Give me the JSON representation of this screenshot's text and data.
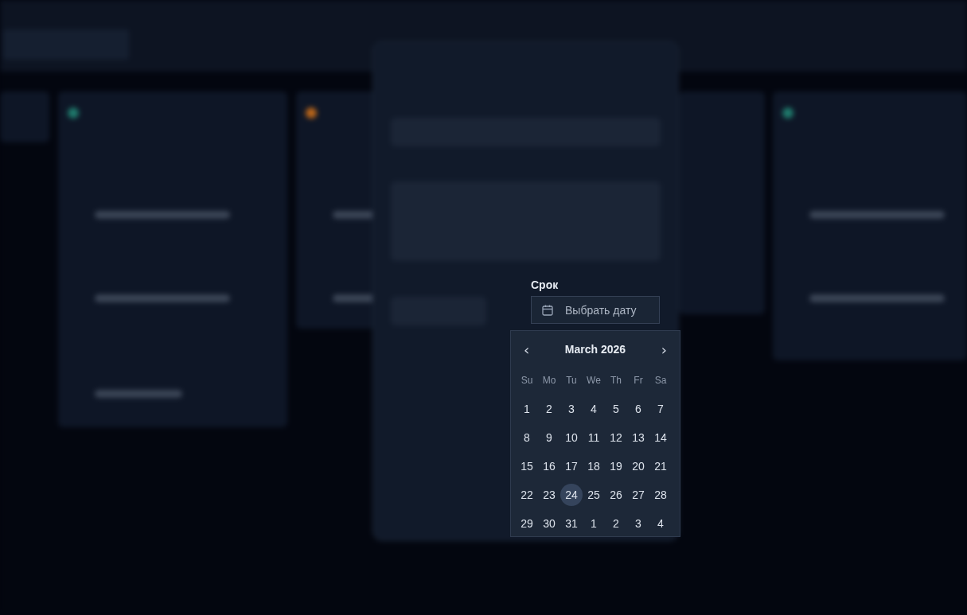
{
  "due_date": {
    "label": "Срок",
    "placeholder": "Выбрать дату"
  },
  "calendar": {
    "month": "March 2026",
    "prev": "‹",
    "next": "›",
    "weekdays": [
      "Su",
      "Mo",
      "Tu",
      "We",
      "Th",
      "Fr",
      "Sa"
    ],
    "weeks": [
      [
        {
          "day": "1",
          "highlighted": false
        },
        {
          "day": "2",
          "highlighted": false
        },
        {
          "day": "3",
          "highlighted": false
        },
        {
          "day": "4",
          "highlighted": false
        },
        {
          "day": "5",
          "highlighted": false
        },
        {
          "day": "6",
          "highlighted": false
        },
        {
          "day": "7",
          "highlighted": false
        }
      ],
      [
        {
          "day": "8",
          "highlighted": false
        },
        {
          "day": "9",
          "highlighted": false
        },
        {
          "day": "10",
          "highlighted": false
        },
        {
          "day": "11",
          "highlighted": false
        },
        {
          "day": "12",
          "highlighted": false
        },
        {
          "day": "13",
          "highlighted": false
        },
        {
          "day": "14",
          "highlighted": false
        }
      ],
      [
        {
          "day": "15",
          "highlighted": false
        },
        {
          "day": "16",
          "highlighted": false
        },
        {
          "day": "17",
          "highlighted": false
        },
        {
          "day": "18",
          "highlighted": false
        },
        {
          "day": "19",
          "highlighted": false
        },
        {
          "day": "20",
          "highlighted": false
        },
        {
          "day": "21",
          "highlighted": false
        }
      ],
      [
        {
          "day": "22",
          "highlighted": false
        },
        {
          "day": "23",
          "highlighted": false
        },
        {
          "day": "24",
          "highlighted": true
        },
        {
          "day": "25",
          "highlighted": false
        },
        {
          "day": "26",
          "highlighted": false
        },
        {
          "day": "27",
          "highlighted": false
        },
        {
          "day": "28",
          "highlighted": false
        }
      ],
      [
        {
          "day": "29",
          "highlighted": false
        },
        {
          "day": "30",
          "highlighted": false
        },
        {
          "day": "31",
          "highlighted": false
        },
        {
          "day": "1",
          "highlighted": false
        },
        {
          "day": "2",
          "highlighted": false
        },
        {
          "day": "3",
          "highlighted": false
        },
        {
          "day": "4",
          "highlighted": false
        }
      ]
    ]
  }
}
